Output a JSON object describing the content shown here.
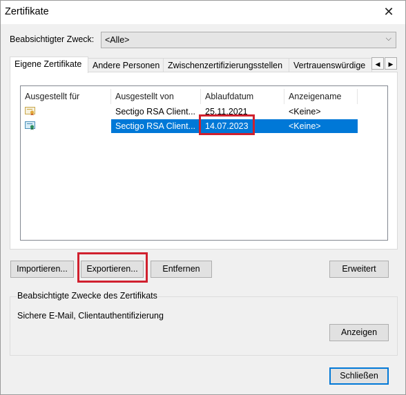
{
  "window": {
    "title": "Zertifikate",
    "close_glyph": "✕"
  },
  "purpose": {
    "label": "Beabsichtigter Zweck:",
    "selected": "<Alle>"
  },
  "tabs": [
    {
      "label": "Eigene Zertifikate",
      "active": true
    },
    {
      "label": "Andere Personen",
      "active": false
    },
    {
      "label": "Zwischenzertifizierungsstellen",
      "active": false
    },
    {
      "label": "Vertrauenswürdige",
      "active": false
    }
  ],
  "tab_scroll": {
    "left": "◀",
    "right": "▶"
  },
  "table": {
    "columns": [
      "Ausgestellt für",
      "Ausgestellt von",
      "Ablaufdatum",
      "Anzeigename"
    ],
    "rows": [
      {
        "issued_to": "",
        "issued_by": "Sectigo RSA Client...",
        "expires": "25.11.2021",
        "friendly_name": "<Keine>",
        "icon": "certificate-icon",
        "selected": false
      },
      {
        "issued_to": "",
        "issued_by": "Sectigo RSA Client...",
        "expires": "14.07.2023",
        "friendly_name": "<Keine>",
        "icon": "certificate-icon",
        "selected": true
      }
    ]
  },
  "buttons": {
    "import": "Importieren...",
    "export": "Exportieren...",
    "remove": "Entfernen",
    "advanced": "Erweitert",
    "view": "Anzeigen",
    "close": "Schließen"
  },
  "purposes_group": {
    "title": "Beabsichtigte Zwecke des Zertifikats",
    "text": "Sichere E-Mail, Clientauthentifizierung"
  },
  "colors": {
    "selection": "#0078d7",
    "highlight_box": "#d0202e"
  }
}
